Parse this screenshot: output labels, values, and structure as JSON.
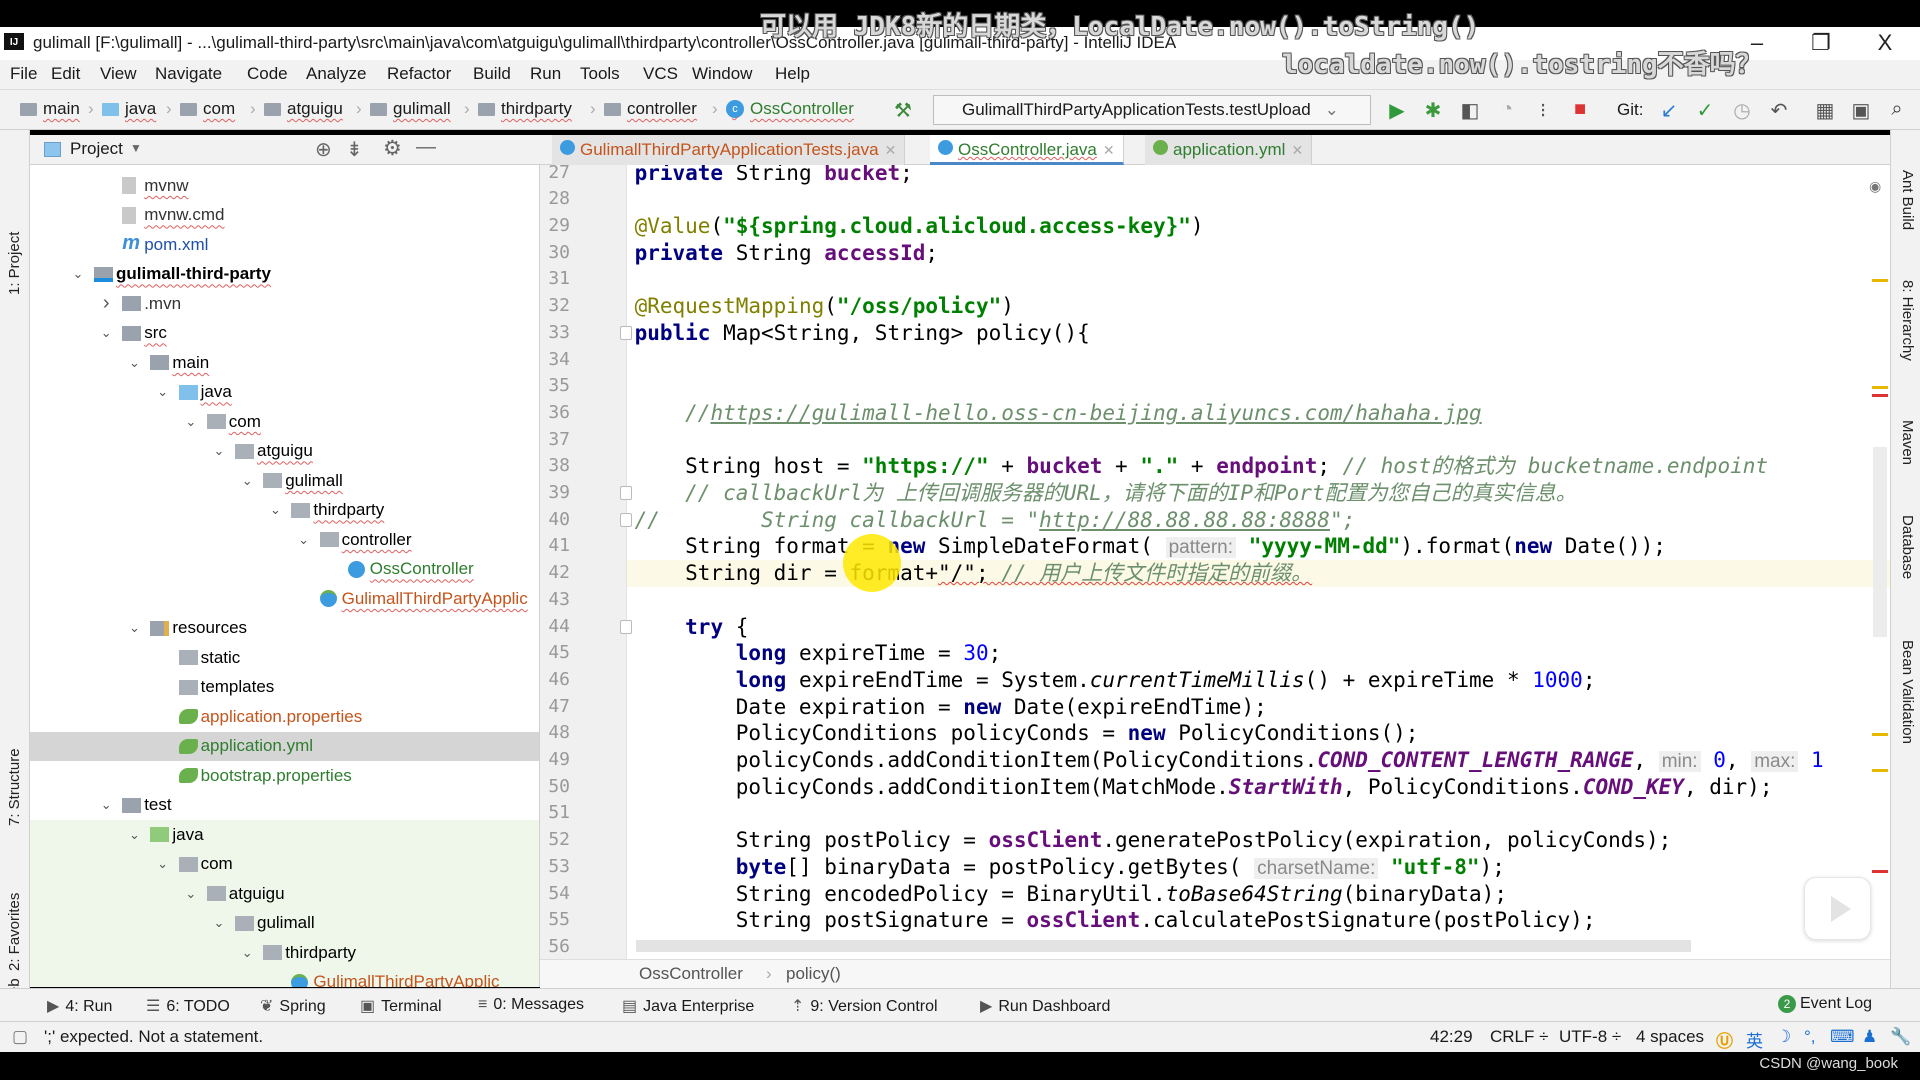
{
  "overlay": {
    "subtitle_1": "可以用 JDK8新的日期类，LocalDate.now().toString()",
    "subtitle_2": "localdate.now().tostring不香吗？",
    "watermark": "CSDN @wang_book"
  },
  "window": {
    "title": "gulimall [F:\\gulimall] - ...\\gulimall-third-party\\src\\main\\java\\com\\atguigu\\gulimall\\thirdparty\\controller\\OssController.java [gulimall-third-party] - IntelliJ IDEA",
    "app_icon": "IJ",
    "minimize": "–",
    "restore": "❐",
    "close": "X"
  },
  "menu": [
    "File",
    "Edit",
    "View",
    "Navigate",
    "Code",
    "Analyze",
    "Refactor",
    "Build",
    "Run",
    "Tools",
    "VCS",
    "Window",
    "Help"
  ],
  "nav_breadcrumb": [
    "main",
    "java",
    "com",
    "atguigu",
    "gulimall",
    "thirdparty",
    "controller",
    "OssController"
  ],
  "toolbar": {
    "run_config": "GulimallThirdPartyApplicationTests.testUpload",
    "git_label": "Git:"
  },
  "left_stripe": [
    "1: Project",
    "7: Structure",
    "2: Favorites",
    "Web"
  ],
  "right_stripe": [
    "Ant Build",
    "8: Hierarchy",
    "Maven",
    "Database",
    "Bean Validation"
  ],
  "project_panel": {
    "title": "Project"
  },
  "tree": [
    {
      "label": "mvnw",
      "level": 1,
      "arrow": "",
      "icon": "file",
      "color": "#333"
    },
    {
      "label": "mvnw.cmd",
      "level": 1,
      "arrow": "",
      "icon": "file",
      "color": "#333"
    },
    {
      "label": "pom.xml",
      "level": 1,
      "arrow": "",
      "icon": "maven",
      "color": "#1e4fa8",
      "nou": true
    },
    {
      "label": "gulimall-third-party",
      "level": 0,
      "arrow": "down",
      "icon": "module",
      "color": "#000",
      "bold": true
    },
    {
      "label": ".mvn",
      "level": 1,
      "arrow": "right",
      "icon": "folder",
      "color": "#333",
      "nou": true
    },
    {
      "label": "src",
      "level": 1,
      "arrow": "down",
      "icon": "folder",
      "color": "#000"
    },
    {
      "label": "main",
      "level": 2,
      "arrow": "down",
      "icon": "folder",
      "color": "#000"
    },
    {
      "label": "java",
      "level": 3,
      "arrow": "down",
      "icon": "src-folder",
      "color": "#000"
    },
    {
      "label": "com",
      "level": 4,
      "arrow": "down",
      "icon": "package",
      "color": "#000"
    },
    {
      "label": "atguigu",
      "level": 5,
      "arrow": "down",
      "icon": "package",
      "color": "#000"
    },
    {
      "label": "gulimall",
      "level": 6,
      "arrow": "down",
      "icon": "package",
      "color": "#000"
    },
    {
      "label": "thirdparty",
      "level": 7,
      "arrow": "down",
      "icon": "package",
      "color": "#000"
    },
    {
      "label": "controller",
      "level": 8,
      "arrow": "down",
      "icon": "package",
      "color": "#000"
    },
    {
      "label": "OssController",
      "level": 9,
      "arrow": "",
      "icon": "class",
      "color": "#2f7d2f"
    },
    {
      "label": "GulimallThirdPartyApplic",
      "level": 8,
      "arrow": "",
      "icon": "spring-class",
      "color": "#c4541b"
    },
    {
      "label": "resources",
      "level": 2,
      "arrow": "down",
      "icon": "resources-folder",
      "color": "#000",
      "nou": true
    },
    {
      "label": "static",
      "level": 3,
      "arrow": "",
      "icon": "package",
      "color": "#000",
      "nou": true
    },
    {
      "label": "templates",
      "level": 3,
      "arrow": "",
      "icon": "package",
      "color": "#000",
      "nou": true
    },
    {
      "label": "application.properties",
      "level": 3,
      "arrow": "",
      "icon": "spring-config",
      "color": "#c4541b",
      "nou": true
    },
    {
      "label": "application.yml",
      "level": 3,
      "arrow": "",
      "icon": "spring-config",
      "color": "#2f7d2f",
      "nou": true,
      "selected": true
    },
    {
      "label": "bootstrap.properties",
      "level": 3,
      "arrow": "",
      "icon": "spring-config",
      "color": "#2f7d2f",
      "nou": true
    },
    {
      "label": "test",
      "level": 1,
      "arrow": "down",
      "icon": "folder",
      "color": "#000",
      "nou": true
    },
    {
      "label": "java",
      "level": 2,
      "arrow": "down",
      "icon": "test-folder",
      "color": "#000",
      "nou": true,
      "test": true
    },
    {
      "label": "com",
      "level": 3,
      "arrow": "down",
      "icon": "package",
      "color": "#000",
      "nou": true,
      "test": true
    },
    {
      "label": "atguigu",
      "level": 4,
      "arrow": "down",
      "icon": "package",
      "color": "#000",
      "nou": true,
      "test": true
    },
    {
      "label": "gulimall",
      "level": 5,
      "arrow": "down",
      "icon": "package",
      "color": "#000",
      "nou": true,
      "test": true
    },
    {
      "label": "thirdparty",
      "level": 6,
      "arrow": "down",
      "icon": "package",
      "color": "#000",
      "nou": true,
      "test": true
    },
    {
      "label": "GulimallThirdPartyApplic",
      "level": 7,
      "arrow": "",
      "icon": "spring-class",
      "color": "#c4541b",
      "test": true
    }
  ],
  "editor_tabs": [
    {
      "label": "GulimallThirdPartyApplicationTests.java",
      "color": "#c4541b",
      "active": false
    },
    {
      "label": "OssController.java",
      "color": "#2f7d2f",
      "active": true
    },
    {
      "label": "application.yml",
      "color": "#2f7d2f",
      "active": false
    }
  ],
  "editor": {
    "caret_line": 42,
    "cursor": "42:29",
    "lines": [
      {
        "n": 27,
        "t": [
          [
            "",
            "    "
          ],
          [
            "k",
            "private"
          ],
          [
            "",
            " String "
          ],
          [
            "f",
            "bucket"
          ],
          [
            "",
            ";"
          ]
        ]
      },
      {
        "n": 28,
        "t": []
      },
      {
        "n": 29,
        "t": [
          [
            "",
            "    "
          ],
          [
            "a",
            "@Value"
          ],
          [
            "",
            "("
          ],
          [
            "s",
            "\"${spring.cloud.alicloud.access-key}\""
          ],
          [
            "",
            ")"
          ]
        ]
      },
      {
        "n": 30,
        "t": [
          [
            "",
            "    "
          ],
          [
            "k",
            "private"
          ],
          [
            "",
            " String "
          ],
          [
            "f",
            "accessId"
          ],
          [
            "",
            ";"
          ]
        ]
      },
      {
        "n": 31,
        "t": []
      },
      {
        "n": 32,
        "t": [
          [
            "",
            "    "
          ],
          [
            "a",
            "@RequestMapping"
          ],
          [
            "",
            "("
          ],
          [
            "s",
            "\"/oss/policy\""
          ],
          [
            "",
            ")"
          ]
        ]
      },
      {
        "n": 33,
        "t": [
          [
            "",
            "    "
          ],
          [
            "k",
            "public"
          ],
          [
            "",
            " Map<String, String> policy(){"
          ]
        ],
        "fold": true
      },
      {
        "n": 34,
        "t": []
      },
      {
        "n": 35,
        "t": []
      },
      {
        "n": 36,
        "t": [
          [
            "",
            "        "
          ],
          [
            "c",
            "//"
          ],
          [
            "cu",
            "https://gulimall-hello.oss-cn-beijing.aliyuncs.com/hahaha.jpg"
          ]
        ]
      },
      {
        "n": 37,
        "t": []
      },
      {
        "n": 38,
        "t": [
          [
            "",
            "        String host = "
          ],
          [
            "s",
            "\"https://\""
          ],
          [
            "",
            " + "
          ],
          [
            "f",
            "bucket"
          ],
          [
            "",
            " + "
          ],
          [
            "s",
            "\".\""
          ],
          [
            "",
            " + "
          ],
          [
            "f",
            "endpoint"
          ],
          [
            "",
            "; "
          ],
          [
            "c",
            "// host的格式为 bucketname.endpoint"
          ]
        ]
      },
      {
        "n": 39,
        "t": [
          [
            "",
            "        "
          ],
          [
            "c",
            "// callbackUrl为 上传回调服务器的URL，请将下面的IP和Port配置为您自己的真实信息。"
          ]
        ],
        "fold": true
      },
      {
        "n": 40,
        "t": [
          [
            "",
            "    "
          ],
          [
            "c",
            "//        String callbackUrl = \""
          ],
          [
            "cu",
            "http://88.88.88.88:8888"
          ],
          [
            "c",
            "\";"
          ]
        ],
        "fold": true
      },
      {
        "n": 41,
        "t": [
          [
            "",
            "        String format = "
          ],
          [
            "k",
            "new"
          ],
          [
            "",
            " SimpleDateFormat( "
          ],
          [
            "h",
            "pattern:"
          ],
          [
            "",
            " "
          ],
          [
            "s",
            "\"yyyy-MM-dd\""
          ],
          [
            "",
            ").format("
          ],
          [
            "k",
            "new"
          ],
          [
            "",
            " Date());"
          ]
        ]
      },
      {
        "n": 42,
        "t": [
          [
            "",
            "        String dir = format+"
          ],
          [
            "e",
            "\"/\"; "
          ],
          [
            "c e",
            "// 用户上传文件时指定的前缀。"
          ]
        ]
      },
      {
        "n": 43,
        "t": []
      },
      {
        "n": 44,
        "t": [
          [
            "",
            "        "
          ],
          [
            "k",
            "try"
          ],
          [
            "",
            " {"
          ]
        ],
        "fold": true
      },
      {
        "n": 45,
        "t": [
          [
            "",
            "            "
          ],
          [
            "k",
            "long"
          ],
          [
            "",
            " expireTime = "
          ],
          [
            "n",
            "30"
          ],
          [
            "",
            ";"
          ]
        ]
      },
      {
        "n": 46,
        "t": [
          [
            "",
            "            "
          ],
          [
            "k",
            "long"
          ],
          [
            "",
            " expireEndTime = System."
          ],
          [
            "i",
            "currentTimeMillis"
          ],
          [
            "",
            "() + expireTime * "
          ],
          [
            "n",
            "1000"
          ],
          [
            "",
            ";"
          ]
        ]
      },
      {
        "n": 47,
        "t": [
          [
            "",
            "            Date expiration = "
          ],
          [
            "k",
            "new"
          ],
          [
            "",
            " Date(expireEndTime);"
          ]
        ]
      },
      {
        "n": 48,
        "t": [
          [
            "",
            "            PolicyConditions policyConds = "
          ],
          [
            "k",
            "new"
          ],
          [
            "",
            " PolicyConditions();"
          ]
        ]
      },
      {
        "n": 49,
        "t": [
          [
            "",
            "            policyConds.addConditionItem(PolicyConditions."
          ],
          [
            "sf",
            "COND_CONTENT_LENGTH_RANGE"
          ],
          [
            "",
            ", "
          ],
          [
            "h",
            "min:"
          ],
          [
            "",
            " "
          ],
          [
            "n",
            "0"
          ],
          [
            "",
            ", "
          ],
          [
            "h",
            "max:"
          ],
          [
            "",
            " "
          ],
          [
            "n",
            "1"
          ]
        ]
      },
      {
        "n": 50,
        "t": [
          [
            "",
            "            policyConds.addConditionItem(MatchMode."
          ],
          [
            "sf",
            "StartWith"
          ],
          [
            "",
            ", PolicyConditions."
          ],
          [
            "sf",
            "COND_KEY"
          ],
          [
            "",
            ", dir);"
          ]
        ]
      },
      {
        "n": 51,
        "t": []
      },
      {
        "n": 52,
        "t": [
          [
            "",
            "            String postPolicy = "
          ],
          [
            "f",
            "ossClient"
          ],
          [
            "",
            ".generatePostPolicy(expiration, policyConds);"
          ]
        ]
      },
      {
        "n": 53,
        "t": [
          [
            "",
            "            "
          ],
          [
            "k",
            "byte"
          ],
          [
            "",
            "[] binaryData = postPolicy.getBytes( "
          ],
          [
            "h",
            "charsetName:"
          ],
          [
            "",
            " "
          ],
          [
            "s",
            "\"utf-8\""
          ],
          [
            "",
            ");"
          ]
        ]
      },
      {
        "n": 54,
        "t": [
          [
            "",
            "            String encodedPolicy = BinaryUtil."
          ],
          [
            "i",
            "toBase64String"
          ],
          [
            "",
            "(binaryData);"
          ]
        ]
      },
      {
        "n": 55,
        "t": [
          [
            "",
            "            String postSignature = "
          ],
          [
            "f",
            "ossClient"
          ],
          [
            "",
            ".calculatePostSignature(postPolicy);"
          ]
        ]
      },
      {
        "n": 56,
        "t": []
      }
    ]
  },
  "editor_breadcrumb": [
    "OssController",
    "policy()"
  ],
  "bottom_tools": [
    {
      "icon": "run-icon",
      "glyph": "▶",
      "label": "4: Run"
    },
    {
      "icon": "todo-icon",
      "glyph": "☰",
      "label": "6: TODO"
    },
    {
      "icon": "spring-icon",
      "glyph": "❦",
      "label": "Spring"
    },
    {
      "icon": "terminal-icon",
      "glyph": "▣",
      "label": "Terminal"
    },
    {
      "icon": "messages-icon",
      "glyph": "≡",
      "label": "0: Messages"
    },
    {
      "icon": "java-enterprise-icon",
      "glyph": "▤",
      "label": "Java Enterprise"
    },
    {
      "icon": "version-control-icon",
      "glyph": "⇡",
      "label": "9: Version Control"
    },
    {
      "icon": "run-dashboard-icon",
      "glyph": "▶",
      "label": "Run Dashboard"
    }
  ],
  "event_log": {
    "badge": "2",
    "label": "Event Log"
  },
  "status": {
    "message": "';' expected. Not a statement.",
    "position": "42:29",
    "line_sep": "CRLF ÷",
    "encoding": "UTF-8 ÷",
    "indent": "4 spaces",
    "ime": "英"
  },
  "colors": {
    "keyword": "#000080",
    "string": "#008000",
    "field": "#660e7a",
    "annotation": "#808000",
    "comment": "#6c8f6c",
    "number": "#0000ff",
    "caret_row": "#fcfae6"
  }
}
